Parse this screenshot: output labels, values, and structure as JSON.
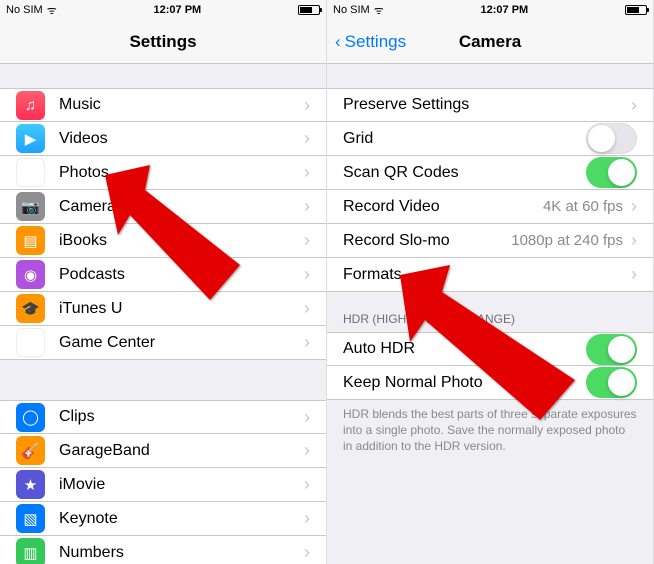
{
  "left": {
    "status": {
      "carrier": "No SIM",
      "wifi": "ᯤ",
      "time": "12:07 PM"
    },
    "nav": {
      "title": "Settings"
    },
    "group1": [
      {
        "label": "Music",
        "iconClass": "ic-music",
        "glyph": "♫"
      },
      {
        "label": "Videos",
        "iconClass": "ic-videos",
        "glyph": "▶"
      },
      {
        "label": "Photos",
        "iconClass": "ic-photos",
        "glyph": "✿"
      },
      {
        "label": "Camera",
        "iconClass": "ic-camera",
        "glyph": "📷"
      },
      {
        "label": "iBooks",
        "iconClass": "ic-ibooks",
        "glyph": "▤"
      },
      {
        "label": "Podcasts",
        "iconClass": "ic-podcasts",
        "glyph": "◉"
      },
      {
        "label": "iTunes U",
        "iconClass": "ic-itunesu",
        "glyph": "🎓"
      },
      {
        "label": "Game Center",
        "iconClass": "ic-gamecenter",
        "glyph": "●●"
      }
    ],
    "group2": [
      {
        "label": "Clips",
        "iconClass": "ic-clips",
        "glyph": "◯"
      },
      {
        "label": "GarageBand",
        "iconClass": "ic-garageband",
        "glyph": "🎸"
      },
      {
        "label": "iMovie",
        "iconClass": "ic-imovie",
        "glyph": "★"
      },
      {
        "label": "Keynote",
        "iconClass": "ic-keynote",
        "glyph": "▧"
      },
      {
        "label": "Numbers",
        "iconClass": "ic-numbers",
        "glyph": "▥"
      }
    ]
  },
  "right": {
    "status": {
      "carrier": "No SIM",
      "wifi": "ᯤ",
      "time": "12:07 PM"
    },
    "nav": {
      "back": "Settings",
      "title": "Camera"
    },
    "group1": [
      {
        "label": "Preserve Settings",
        "type": "chevron"
      },
      {
        "label": "Grid",
        "type": "toggle",
        "on": false
      },
      {
        "label": "Scan QR Codes",
        "type": "toggle",
        "on": true
      },
      {
        "label": "Record Video",
        "type": "value",
        "value": "4K at 60 fps"
      },
      {
        "label": "Record Slo-mo",
        "type": "value",
        "value": "1080p at 240 fps"
      },
      {
        "label": "Formats",
        "type": "chevron"
      }
    ],
    "hdrHeader": "HDR (HIGH DYNAMIC RANGE)",
    "group2": [
      {
        "label": "Auto HDR",
        "type": "toggle",
        "on": true
      },
      {
        "label": "Keep Normal Photo",
        "type": "toggle",
        "on": true
      }
    ],
    "hdrFooter": "HDR blends the best parts of three separate exposures into a single photo. Save the normally exposed photo in addition to the HDR version."
  }
}
